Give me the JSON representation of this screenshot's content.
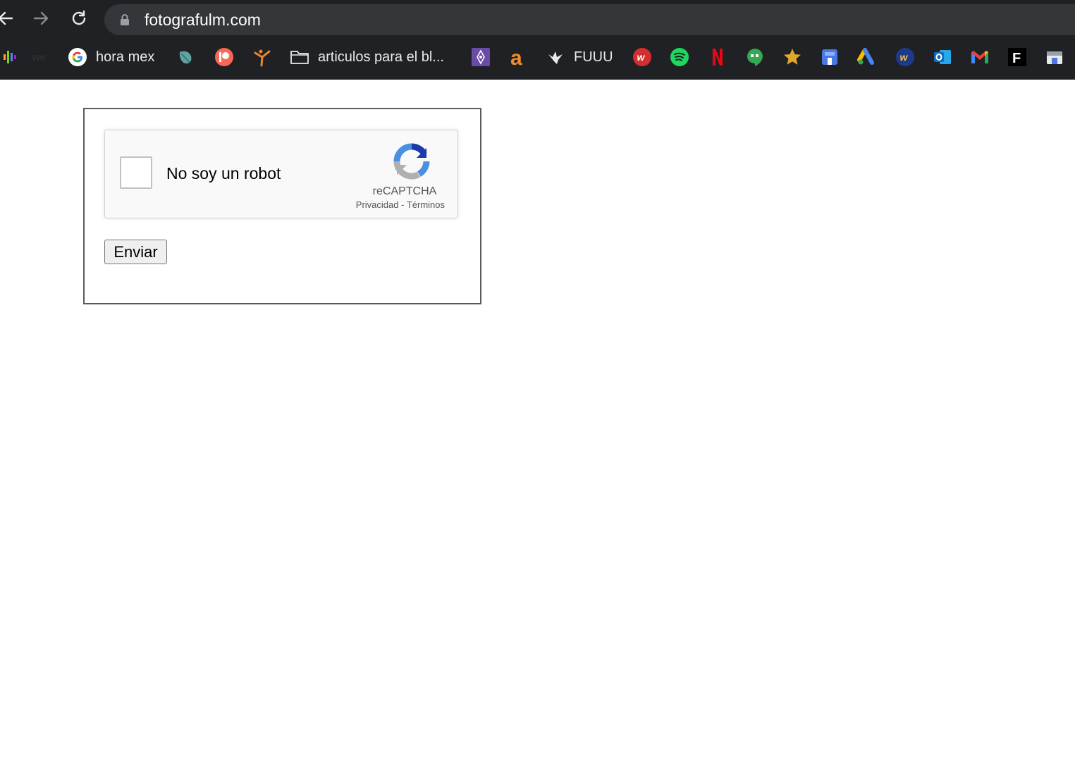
{
  "browser": {
    "url": "fotografulm.com",
    "nav": {
      "back_icon": "arrow-left-icon",
      "forward_icon": "arrow-right-icon",
      "reload_icon": "reload-icon"
    }
  },
  "bookmarks": {
    "items": [
      {
        "icon": "podcast-bars-icon",
        "label": ""
      },
      {
        "icon": "we-icon",
        "label": ""
      },
      {
        "icon": "google-icon",
        "label": "hora mex"
      },
      {
        "icon": "leaf-icon",
        "label": ""
      },
      {
        "icon": "patreon-icon",
        "label": ""
      },
      {
        "icon": "figure-icon",
        "label": ""
      },
      {
        "icon": "folder-icon",
        "label": "articulos para el bl..."
      },
      {
        "icon": "purple-diamond-icon",
        "label": ""
      },
      {
        "icon": "a-orange-icon",
        "label": ""
      },
      {
        "icon": "bird-icon",
        "label": "FUUU"
      },
      {
        "icon": "red-w-icon",
        "label": ""
      },
      {
        "icon": "spotify-icon",
        "label": ""
      },
      {
        "icon": "netflix-icon",
        "label": ""
      },
      {
        "icon": "hangouts-icon",
        "label": ""
      },
      {
        "icon": "star-icon",
        "label": ""
      },
      {
        "icon": "store-blue-icon",
        "label": ""
      },
      {
        "icon": "google-ads-icon",
        "label": ""
      },
      {
        "icon": "blue-w-icon",
        "label": ""
      },
      {
        "icon": "outlook-icon",
        "label": ""
      },
      {
        "icon": "gmail-icon",
        "label": ""
      },
      {
        "icon": "f-icon",
        "label": ""
      },
      {
        "icon": "store-icon",
        "label": ""
      }
    ]
  },
  "form": {
    "captcha": {
      "label": "No soy un robot",
      "brand": "reCAPTCHA",
      "privacy": "Privacidad",
      "separator": " - ",
      "terms": "Términos",
      "checked": false
    },
    "submit_label": "Enviar"
  },
  "colors": {
    "chrome_bg": "#202124",
    "omnibox_bg": "#35363a",
    "recaptcha_blue": "#1c3aa9",
    "recaptcha_lightblue": "#4a90e2",
    "recaptcha_gray": "#b0b0b0"
  }
}
